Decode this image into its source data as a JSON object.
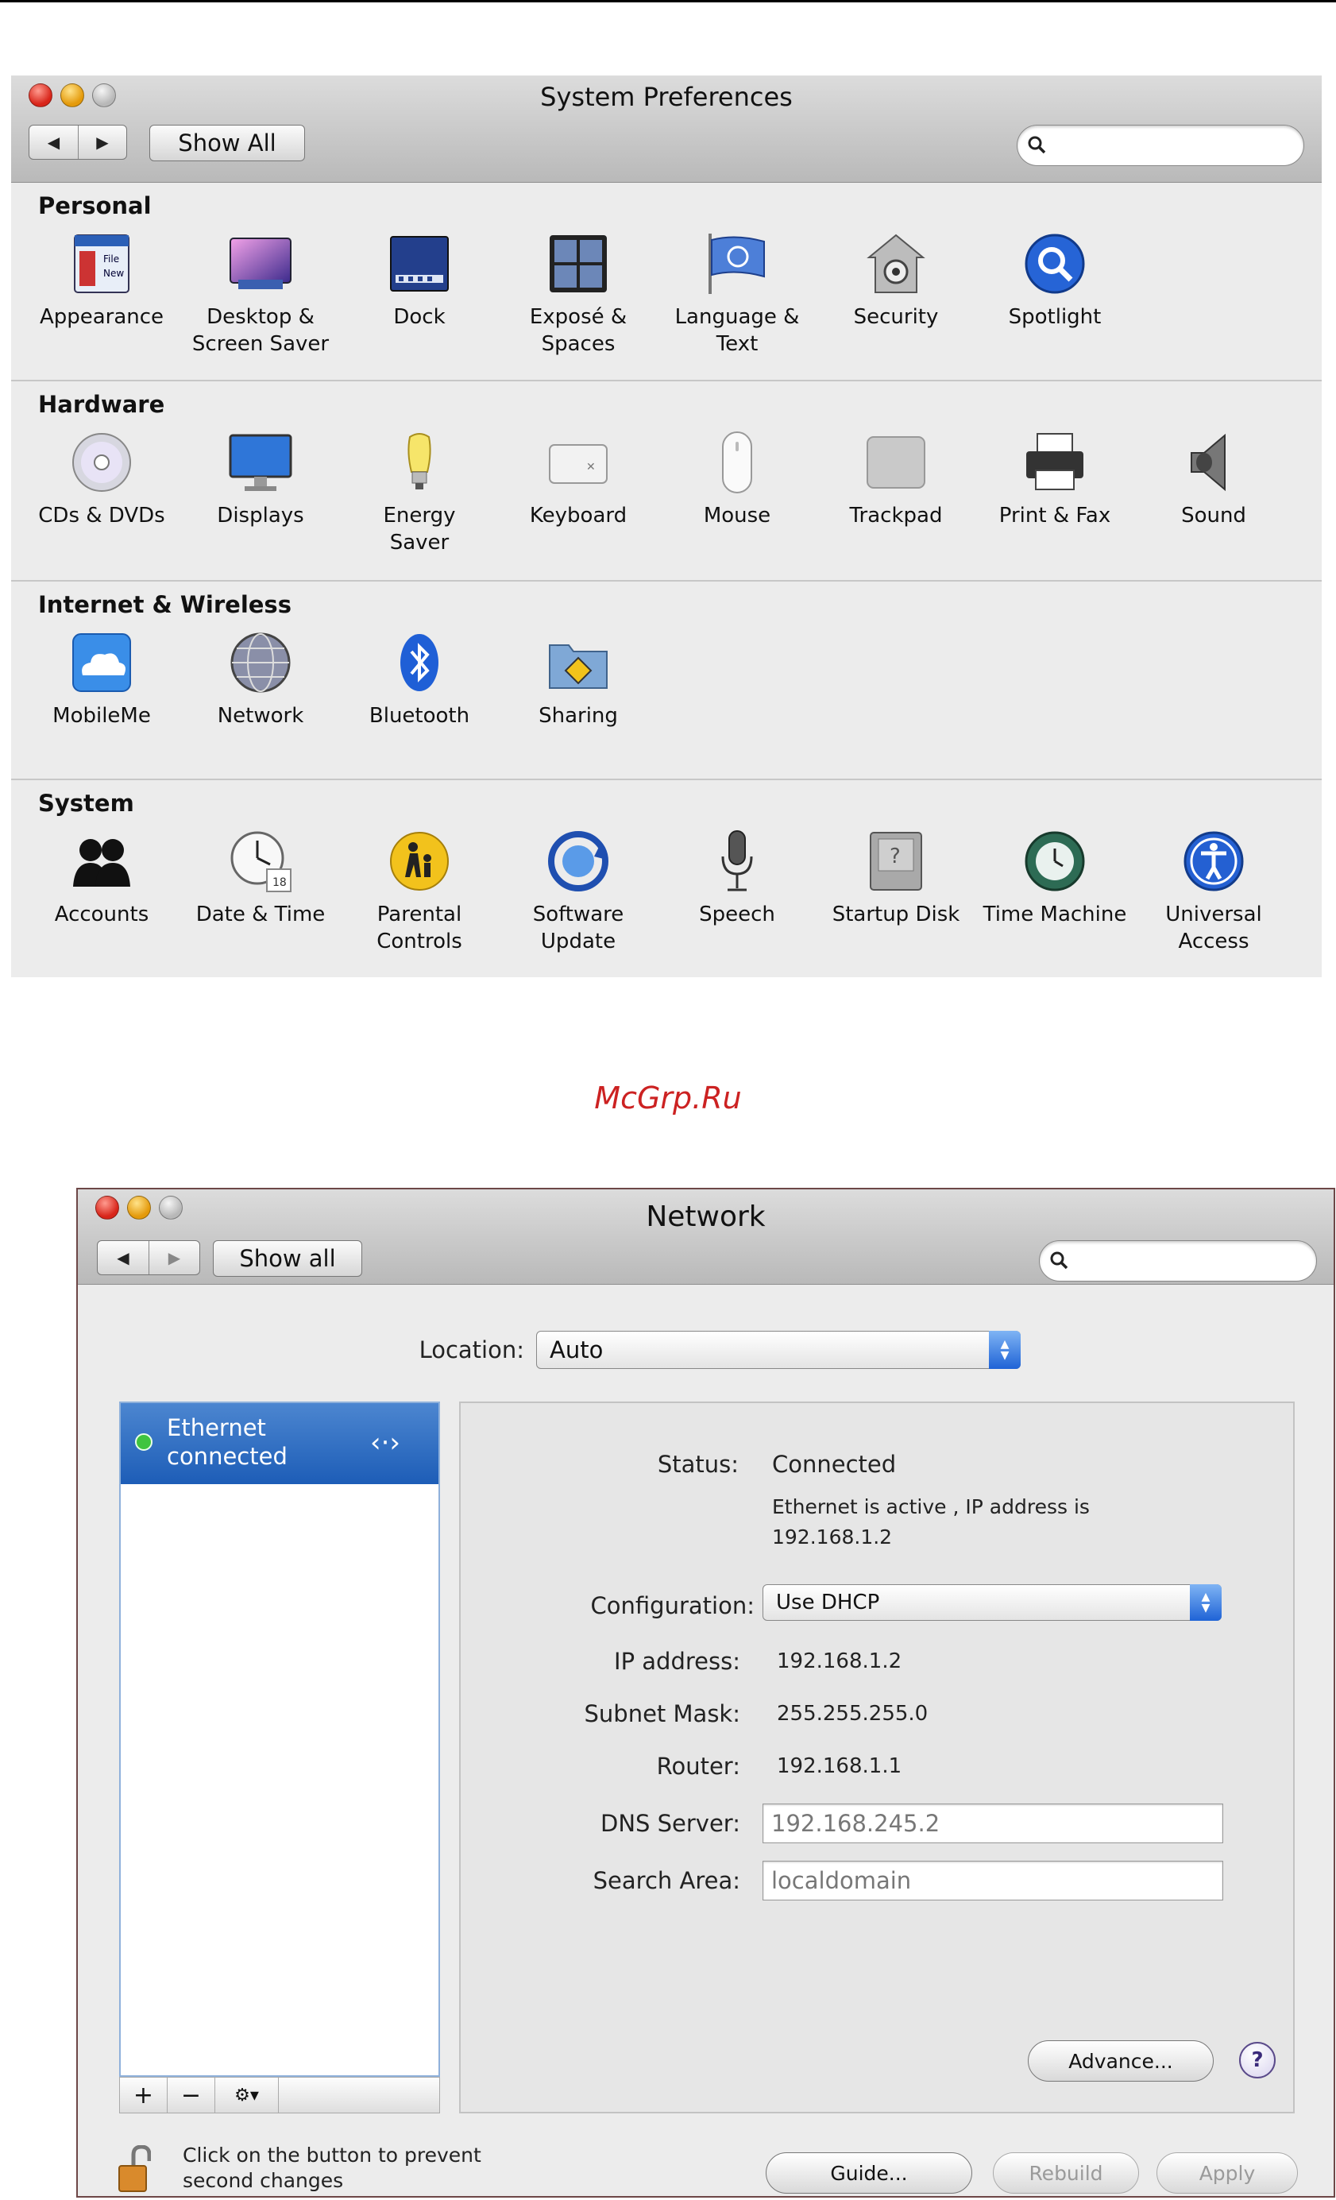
{
  "prefs": {
    "title": "System Preferences",
    "show_all_label": "Show All",
    "sections": [
      {
        "heading": "Personal",
        "items": [
          {
            "label": "Appearance",
            "icon": "appearance-icon"
          },
          {
            "label": "Desktop &\nScreen Saver",
            "icon": "desktop-icon"
          },
          {
            "label": "Dock",
            "icon": "dock-icon"
          },
          {
            "label": "Exposé &\nSpaces",
            "icon": "expose-icon"
          },
          {
            "label": "Language &\nText",
            "icon": "language-icon"
          },
          {
            "label": "Security",
            "icon": "security-icon"
          },
          {
            "label": "Spotlight",
            "icon": "spotlight-icon"
          }
        ]
      },
      {
        "heading": "Hardware",
        "items": [
          {
            "label": "CDs & DVDs",
            "icon": "cd-icon"
          },
          {
            "label": "Displays",
            "icon": "display-icon"
          },
          {
            "label": "Energy\nSaver",
            "icon": "bulb-icon"
          },
          {
            "label": "Keyboard",
            "icon": "keyboard-icon"
          },
          {
            "label": "Mouse",
            "icon": "mouse-icon"
          },
          {
            "label": "Trackpad",
            "icon": "trackpad-icon"
          },
          {
            "label": "Print & Fax",
            "icon": "printer-icon"
          },
          {
            "label": "Sound",
            "icon": "speaker-icon"
          }
        ]
      },
      {
        "heading": "Internet & Wireless",
        "items": [
          {
            "label": "MobileMe",
            "icon": "cloud-icon"
          },
          {
            "label": "Network",
            "icon": "globe-icon"
          },
          {
            "label": "Bluetooth",
            "icon": "bluetooth-icon"
          },
          {
            "label": "Sharing",
            "icon": "sharing-folder-icon"
          }
        ]
      },
      {
        "heading": "System",
        "items": [
          {
            "label": "Accounts",
            "icon": "accounts-icon"
          },
          {
            "label": "Date & Time",
            "icon": "clock-icon"
          },
          {
            "label": "Parental\nControls",
            "icon": "parental-icon"
          },
          {
            "label": "Software\nUpdate",
            "icon": "update-icon"
          },
          {
            "label": "Speech",
            "icon": "microphone-icon"
          },
          {
            "label": "Startup Disk",
            "icon": "disk-icon"
          },
          {
            "label": "Time Machine",
            "icon": "time-machine-icon"
          },
          {
            "label": "Universal\nAccess",
            "icon": "accessibility-icon"
          }
        ]
      }
    ]
  },
  "watermark": "McGrp.Ru",
  "network": {
    "title": "Network",
    "show_all_label": "Show all",
    "location_label": "Location:",
    "location_value": "Auto",
    "service": {
      "name": "Ethernet",
      "state": "connected",
      "status_color": "#3fc43f"
    },
    "status_label": "Status:",
    "status_value": "Connected",
    "status_detail_1": "Ethernet is active , IP address is",
    "status_detail_2": "192.168.1.2",
    "configuration_label": "Configuration:",
    "configuration_value": "Use DHCP",
    "ip_label": "IP address:",
    "ip_value": "192.168.1.2",
    "subnet_label": "Subnet Mask:",
    "subnet_value": "255.255.255.0",
    "router_label": "Router:",
    "router_value": "192.168.1.1",
    "dns_label": "DNS Server:",
    "dns_value": "192.168.245.2",
    "search_label": "Search Area:",
    "search_value": "localdomain",
    "add_label": "+",
    "remove_label": "−",
    "gear_label": "⚙▾",
    "advance_label": "Advance...",
    "help_label": "?",
    "lock_text_1": "Click on the button to prevent",
    "lock_text_2": "second changes",
    "guide_label": "Guide...",
    "rebuild_label": "Rebuild",
    "apply_label": "Apply"
  }
}
